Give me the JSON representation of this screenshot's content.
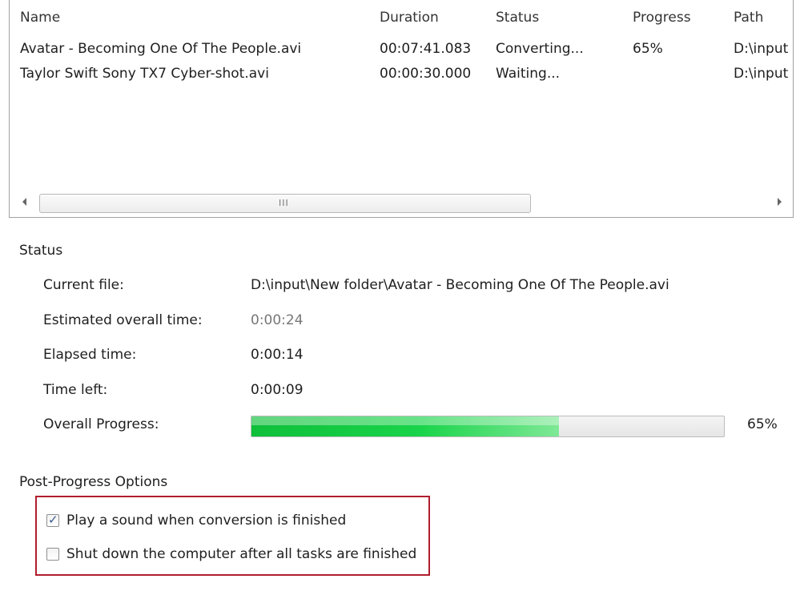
{
  "file_list": {
    "columns": {
      "name": "Name",
      "duration": "Duration",
      "status": "Status",
      "progress": "Progress",
      "path": "Path"
    },
    "rows": [
      {
        "name": "Avatar - Becoming One Of The People.avi",
        "duration": "00:07:41.083",
        "status": "Converting...",
        "progress": "65%",
        "path": "D:\\input"
      },
      {
        "name": "Taylor Swift Sony TX7 Cyber-shot.avi",
        "duration": "00:00:30.000",
        "status": "Waiting...",
        "progress": "",
        "path": "D:\\input"
      }
    ],
    "scroll_grip": "III"
  },
  "status_section": {
    "title": "Status",
    "current_file_label": "Current file:",
    "current_file_value": "D:\\input\\New folder\\Avatar - Becoming One Of The People.avi",
    "estimated_label": "Estimated overall time:",
    "estimated_value": "0:00:24",
    "elapsed_label": "Elapsed time:",
    "elapsed_value": "0:00:14",
    "time_left_label": "Time left:",
    "time_left_value": "0:00:09",
    "overall_progress_label": "Overall Progress:",
    "overall_progress_value": 65,
    "overall_progress_text": "65%"
  },
  "post_options": {
    "title": "Post-Progress Options",
    "play_sound_label": "Play a sound when conversion is finished",
    "play_sound_checked": true,
    "shutdown_label": "Shut down the computer after all tasks are finished",
    "shutdown_checked": false
  },
  "colors": {
    "highlight_border": "#b01e2e",
    "progress_green": "#19d44a"
  }
}
